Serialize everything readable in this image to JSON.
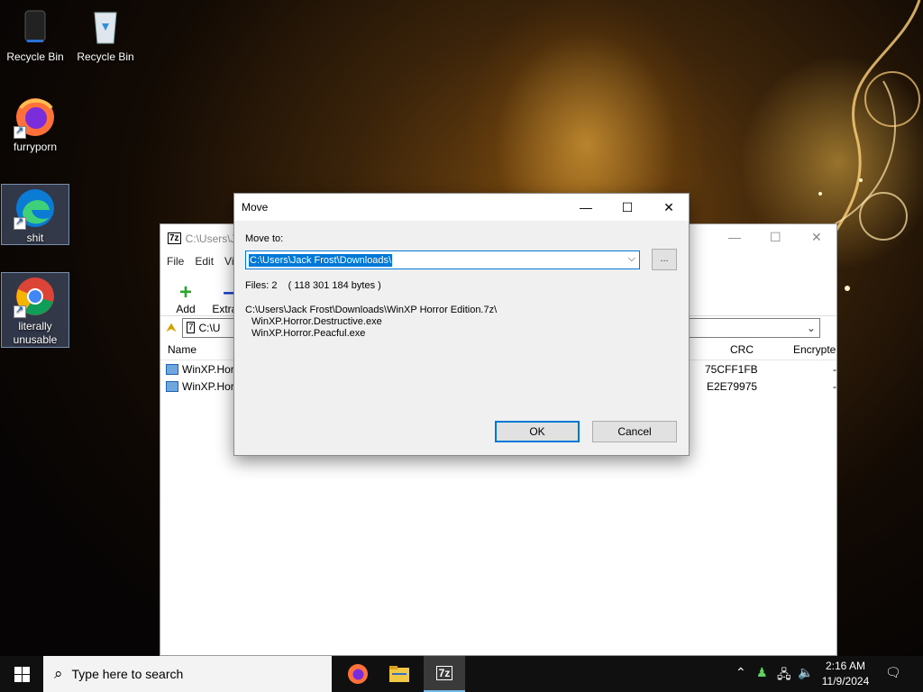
{
  "desktop": {
    "icons": [
      {
        "label": "Recycle Bin"
      },
      {
        "label": "Recycle Bin"
      },
      {
        "label": "furryporn"
      },
      {
        "label": "shit"
      },
      {
        "label": "literally unusable"
      }
    ]
  },
  "zip_window": {
    "title": "C:\\Users\\J",
    "menu": [
      "File",
      "Edit",
      "Vi"
    ],
    "toolbar": {
      "add": "Add",
      "extract": "Extract"
    },
    "address": "C:\\U",
    "columns": {
      "name": "Name",
      "crc": "CRC",
      "encrypted": "Encrypte"
    },
    "rows": [
      {
        "name": "WinXP.Hor",
        "crc": "75CFF1FB",
        "encrypted": "-"
      },
      {
        "name": "WinXP.Hor",
        "crc": "E2E79975",
        "encrypted": "-"
      }
    ]
  },
  "dialog": {
    "title": "Move",
    "move_to_label": "Move to:",
    "path": "C:\\Users\\Jack Frost\\Downloads\\",
    "browse_label": "...",
    "files_info": "Files: 2    ( 118 301 184 bytes )",
    "source_path": "C:\\Users\\Jack Frost\\Downloads\\WinXP Horror Edition.7z\\",
    "files": [
      "WinXP.Horror.Destructive.exe",
      "WinXP.Horror.Peacful.exe"
    ],
    "ok_label": "OK",
    "cancel_label": "Cancel"
  },
  "taskbar": {
    "search_placeholder": "Type here to search",
    "time": "2:16 AM",
    "date": "11/9/2024",
    "app_7z_label": "7z"
  },
  "colors": {
    "accent": "#0078d7",
    "taskbar": "#101010"
  }
}
